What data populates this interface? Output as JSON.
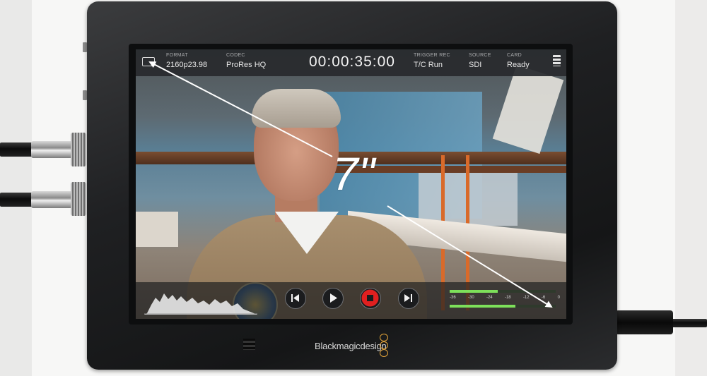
{
  "status_bar": {
    "format": {
      "label": "FORMAT",
      "value": "2160p23.98"
    },
    "codec": {
      "label": "CODEC",
      "value": "ProRes HQ"
    },
    "timecode": "00:00:35:00",
    "trigger_rec": {
      "label": "TRIGGER REC",
      "value": "T/C Run"
    },
    "source": {
      "label": "SOURCE",
      "value": "SDI"
    },
    "card": {
      "label": "CARD",
      "value": "Ready"
    }
  },
  "transport": {
    "icons": [
      "skip-back-icon",
      "play-icon",
      "record-stop-icon",
      "skip-forward-icon"
    ]
  },
  "audio_meter": {
    "ticks": [
      "-36",
      "-30",
      "-24",
      "-18",
      "-12",
      "-6",
      "0"
    ],
    "channel_levels": [
      0.45,
      0.62
    ]
  },
  "device": {
    "brand": "Blackmagicdesign"
  },
  "annotation": {
    "screen_size": "7\""
  },
  "colors": {
    "record": "#e02020",
    "meter": "#7de05a",
    "logo": "#e2a33a"
  }
}
